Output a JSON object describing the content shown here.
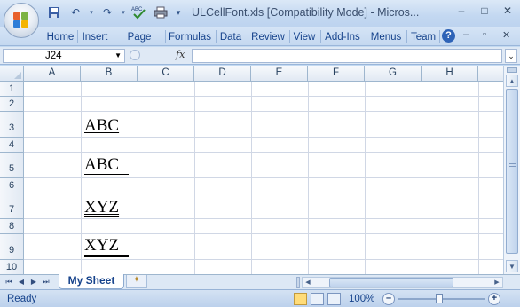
{
  "window": {
    "title": "ULCellFont.xls  [Compatibility Mode] - Micros...",
    "controls": [
      "–",
      "□",
      "✕"
    ]
  },
  "ribbon": {
    "tabs": [
      "Home",
      "Insert",
      "Page Layo",
      "Formulas",
      "Data",
      "Review",
      "View",
      "Add-Ins",
      "Menus",
      "Team"
    ]
  },
  "formula_bar": {
    "name_box": "J24",
    "fx": "fx",
    "value": ""
  },
  "sheet": {
    "columns": [
      "A",
      "B",
      "C",
      "D",
      "E",
      "F",
      "G",
      "H"
    ],
    "rows": [
      "1",
      "2",
      "3",
      "4",
      "5",
      "6",
      "7",
      "8",
      "9",
      "10"
    ],
    "cells": {
      "B3": "ABC",
      "B5": "ABC",
      "B7": "XYZ",
      "B9": "XYZ"
    }
  },
  "sheet_tabs": {
    "active": "My Sheet"
  },
  "status": {
    "text": "Ready",
    "zoom": "100%",
    "zoom_fraction": 0.5
  }
}
